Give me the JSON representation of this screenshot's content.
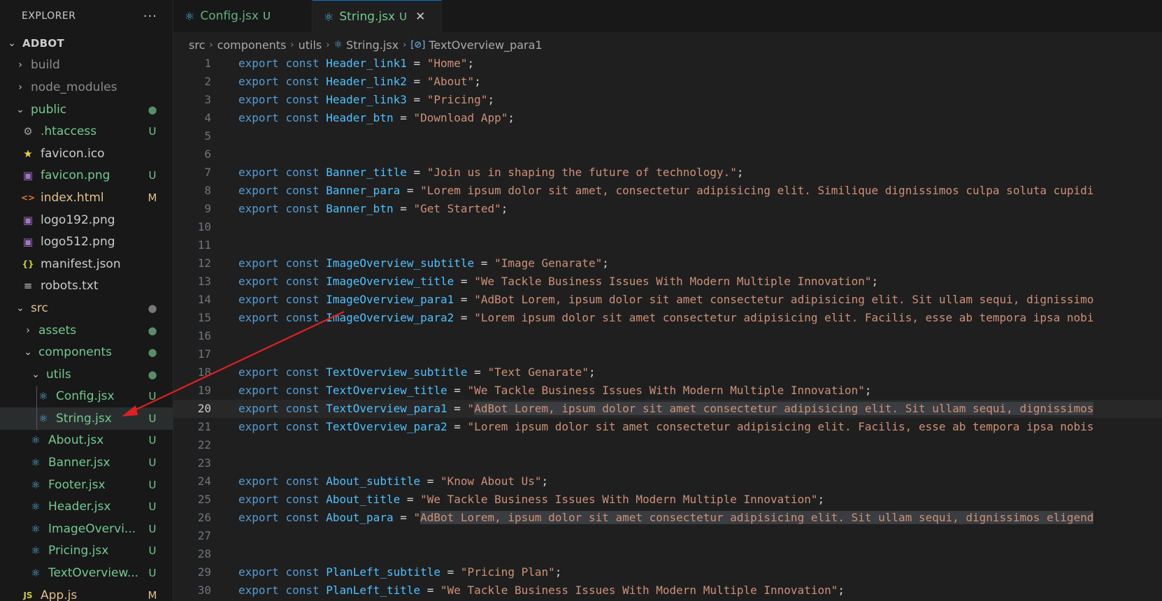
{
  "sidebar": {
    "title": "EXPLORER",
    "more_icon": "more-icon",
    "root": "ADBOT",
    "items": [
      {
        "label": "build",
        "type": "folder",
        "expanded": false,
        "depth": 1,
        "status": "ignored",
        "badge": ""
      },
      {
        "label": "node_modules",
        "type": "folder",
        "expanded": false,
        "depth": 1,
        "status": "ignored",
        "badge": ""
      },
      {
        "label": "public",
        "type": "folder",
        "expanded": true,
        "depth": 1,
        "status": "untracked",
        "badge": "●"
      },
      {
        "label": ".htaccess",
        "type": "file",
        "icon": "gear-icon",
        "depth": 2,
        "status": "untracked",
        "badge": "U"
      },
      {
        "label": "favicon.ico",
        "type": "file",
        "icon": "star-icon",
        "depth": 2,
        "status": "default",
        "badge": ""
      },
      {
        "label": "favicon.png",
        "type": "file",
        "icon": "image-icon",
        "depth": 2,
        "status": "untracked",
        "badge": "U"
      },
      {
        "label": "index.html",
        "type": "file",
        "icon": "html-icon",
        "depth": 2,
        "status": "modified",
        "badge": "M"
      },
      {
        "label": "logo192.png",
        "type": "file",
        "icon": "image-icon",
        "depth": 2,
        "status": "default",
        "badge": ""
      },
      {
        "label": "logo512.png",
        "type": "file",
        "icon": "image-icon",
        "depth": 2,
        "status": "default",
        "badge": ""
      },
      {
        "label": "manifest.json",
        "type": "file",
        "icon": "json-icon",
        "depth": 2,
        "status": "default",
        "badge": ""
      },
      {
        "label": "robots.txt",
        "type": "file",
        "icon": "text-file-icon",
        "depth": 2,
        "status": "default",
        "badge": ""
      },
      {
        "label": "src",
        "type": "folder",
        "expanded": true,
        "depth": 1,
        "status": "modified",
        "badge": "●"
      },
      {
        "label": "assets",
        "type": "folder",
        "expanded": false,
        "depth": 2,
        "status": "untracked",
        "badge": "●"
      },
      {
        "label": "components",
        "type": "folder",
        "expanded": true,
        "depth": 2,
        "status": "untracked",
        "badge": "●"
      },
      {
        "label": "utils",
        "type": "folder",
        "expanded": true,
        "depth": 3,
        "status": "untracked",
        "badge": "●"
      },
      {
        "label": "Config.jsx",
        "type": "file",
        "icon": "react-icon",
        "depth": 4,
        "status": "untracked",
        "badge": "U"
      },
      {
        "label": "String.jsx",
        "type": "file",
        "icon": "react-icon",
        "depth": 4,
        "status": "untracked",
        "badge": "U",
        "selected": true
      },
      {
        "label": "About.jsx",
        "type": "file",
        "icon": "react-icon",
        "depth": 3,
        "status": "untracked",
        "badge": "U"
      },
      {
        "label": "Banner.jsx",
        "type": "file",
        "icon": "react-icon",
        "depth": 3,
        "status": "untracked",
        "badge": "U"
      },
      {
        "label": "Footer.jsx",
        "type": "file",
        "icon": "react-icon",
        "depth": 3,
        "status": "untracked",
        "badge": "U"
      },
      {
        "label": "Header.jsx",
        "type": "file",
        "icon": "react-icon",
        "depth": 3,
        "status": "untracked",
        "badge": "U"
      },
      {
        "label": "ImageOvervi...",
        "type": "file",
        "icon": "react-icon",
        "depth": 3,
        "status": "untracked",
        "badge": "U"
      },
      {
        "label": "Pricing.jsx",
        "type": "file",
        "icon": "react-icon",
        "depth": 3,
        "status": "untracked",
        "badge": "U"
      },
      {
        "label": "TextOverview...",
        "type": "file",
        "icon": "react-icon",
        "depth": 3,
        "status": "untracked",
        "badge": "U"
      },
      {
        "label": "App.js",
        "type": "file",
        "icon": "js-icon",
        "depth": 2,
        "status": "modified",
        "badge": "M"
      }
    ]
  },
  "tabs": [
    {
      "label": "Config.jsx",
      "badge": "U",
      "active": false
    },
    {
      "label": "String.jsx",
      "badge": "U",
      "active": true,
      "close": "✕"
    }
  ],
  "breadcrumb": {
    "parts": [
      "src",
      "components",
      "utils"
    ],
    "file": "String.jsx",
    "symbol": "TextOverview_para1"
  },
  "editor": {
    "current_line": 20,
    "lines": [
      {
        "n": "1",
        "tokens": [
          [
            "kw",
            "export"
          ],
          [
            "op",
            " "
          ],
          [
            "kw",
            "const"
          ],
          [
            "op",
            " "
          ],
          [
            "id",
            "Header_link1"
          ],
          [
            "op",
            " = "
          ],
          [
            "str",
            "\"Home\""
          ],
          [
            "op",
            ";"
          ]
        ]
      },
      {
        "n": "2",
        "tokens": [
          [
            "kw",
            "export"
          ],
          [
            "op",
            " "
          ],
          [
            "kw",
            "const"
          ],
          [
            "op",
            " "
          ],
          [
            "id",
            "Header_link2"
          ],
          [
            "op",
            " = "
          ],
          [
            "str",
            "\"About\""
          ],
          [
            "op",
            ";"
          ]
        ]
      },
      {
        "n": "3",
        "tokens": [
          [
            "kw",
            "export"
          ],
          [
            "op",
            " "
          ],
          [
            "kw",
            "const"
          ],
          [
            "op",
            " "
          ],
          [
            "id",
            "Header_link3"
          ],
          [
            "op",
            " = "
          ],
          [
            "str",
            "\"Pricing\""
          ],
          [
            "op",
            ";"
          ]
        ]
      },
      {
        "n": "4",
        "tokens": [
          [
            "kw",
            "export"
          ],
          [
            "op",
            " "
          ],
          [
            "kw",
            "const"
          ],
          [
            "op",
            " "
          ],
          [
            "id",
            "Header_btn"
          ],
          [
            "op",
            " = "
          ],
          [
            "str",
            "\"Download App\""
          ],
          [
            "op",
            ";"
          ]
        ]
      },
      {
        "n": "5",
        "tokens": []
      },
      {
        "n": "6",
        "tokens": []
      },
      {
        "n": "7",
        "tokens": [
          [
            "kw",
            "export"
          ],
          [
            "op",
            " "
          ],
          [
            "kw",
            "const"
          ],
          [
            "op",
            " "
          ],
          [
            "id",
            "Banner_title"
          ],
          [
            "op",
            " = "
          ],
          [
            "str",
            "\"Join us in shaping the future of technology.\""
          ],
          [
            "op",
            ";"
          ]
        ]
      },
      {
        "n": "8",
        "tokens": [
          [
            "kw",
            "export"
          ],
          [
            "op",
            " "
          ],
          [
            "kw",
            "const"
          ],
          [
            "op",
            " "
          ],
          [
            "id",
            "Banner_para"
          ],
          [
            "op",
            " = "
          ],
          [
            "str",
            "\"Lorem ipsum dolor sit amet, consectetur adipisicing elit. Similique dignissimos culpa soluta cupidi"
          ]
        ]
      },
      {
        "n": "9",
        "tokens": [
          [
            "kw",
            "export"
          ],
          [
            "op",
            " "
          ],
          [
            "kw",
            "const"
          ],
          [
            "op",
            " "
          ],
          [
            "id",
            "Banner_btn"
          ],
          [
            "op",
            " = "
          ],
          [
            "str",
            "\"Get Started\""
          ],
          [
            "op",
            ";"
          ]
        ]
      },
      {
        "n": "10",
        "tokens": []
      },
      {
        "n": "11",
        "tokens": []
      },
      {
        "n": "12",
        "tokens": [
          [
            "kw",
            "export"
          ],
          [
            "op",
            " "
          ],
          [
            "kw",
            "const"
          ],
          [
            "op",
            " "
          ],
          [
            "id",
            "ImageOverview_subtitle"
          ],
          [
            "op",
            " = "
          ],
          [
            "str",
            "\"Image Genarate\""
          ],
          [
            "op",
            ";"
          ]
        ]
      },
      {
        "n": "13",
        "tokens": [
          [
            "kw",
            "export"
          ],
          [
            "op",
            " "
          ],
          [
            "kw",
            "const"
          ],
          [
            "op",
            " "
          ],
          [
            "id",
            "ImageOverview_title"
          ],
          [
            "op",
            " = "
          ],
          [
            "str",
            "\"We Tackle Business Issues With Modern Multiple Innovation\""
          ],
          [
            "op",
            ";"
          ]
        ]
      },
      {
        "n": "14",
        "tokens": [
          [
            "kw",
            "export"
          ],
          [
            "op",
            " "
          ],
          [
            "kw",
            "const"
          ],
          [
            "op",
            " "
          ],
          [
            "id",
            "ImageOverview_para1"
          ],
          [
            "op",
            " = "
          ],
          [
            "str",
            "\"AdBot Lorem, ipsum dolor sit amet consectetur adipisicing elit. Sit ullam sequi, dignissimo"
          ]
        ]
      },
      {
        "n": "15",
        "tokens": [
          [
            "kw",
            "export"
          ],
          [
            "op",
            " "
          ],
          [
            "kw",
            "const"
          ],
          [
            "op",
            " "
          ],
          [
            "id",
            "ImageOverview_para2"
          ],
          [
            "op",
            " = "
          ],
          [
            "str",
            "\"Lorem ipsum dolor sit amet consectetur adipisicing elit. Facilis, esse ab tempora ipsa nobi"
          ]
        ]
      },
      {
        "n": "16",
        "tokens": []
      },
      {
        "n": "17",
        "tokens": []
      },
      {
        "n": "18",
        "tokens": [
          [
            "kw",
            "export"
          ],
          [
            "op",
            " "
          ],
          [
            "kw",
            "const"
          ],
          [
            "op",
            " "
          ],
          [
            "id",
            "TextOverview_subtitle"
          ],
          [
            "op",
            " = "
          ],
          [
            "str",
            "\"Text Genarate\""
          ],
          [
            "op",
            ";"
          ]
        ]
      },
      {
        "n": "19",
        "tokens": [
          [
            "kw",
            "export"
          ],
          [
            "op",
            " "
          ],
          [
            "kw",
            "const"
          ],
          [
            "op",
            " "
          ],
          [
            "id",
            "TextOverview_title"
          ],
          [
            "op",
            " = "
          ],
          [
            "str",
            "\"We Tackle Business Issues With Modern Multiple Innovation\""
          ],
          [
            "op",
            ";"
          ]
        ]
      },
      {
        "n": "20",
        "tokens": [
          [
            "kw",
            "export"
          ],
          [
            "op",
            " "
          ],
          [
            "kw",
            "const"
          ],
          [
            "op",
            " "
          ],
          [
            "id",
            "TextOverview_para1"
          ],
          [
            "op",
            " = "
          ],
          [
            "str",
            "\""
          ],
          [
            "strhl",
            "AdBot Lorem, ipsum dolor sit amet consectetur adipisicing elit. Sit ullam sequi, dignissimos"
          ]
        ]
      },
      {
        "n": "21",
        "tokens": [
          [
            "kw",
            "export"
          ],
          [
            "op",
            " "
          ],
          [
            "kw",
            "const"
          ],
          [
            "op",
            " "
          ],
          [
            "id",
            "TextOverview_para2"
          ],
          [
            "op",
            " = "
          ],
          [
            "str",
            "\"Lorem ipsum dolor sit amet consectetur adipisicing elit. Facilis, esse ab tempora ipsa nobis"
          ]
        ]
      },
      {
        "n": "22",
        "tokens": []
      },
      {
        "n": "23",
        "tokens": []
      },
      {
        "n": "24",
        "tokens": [
          [
            "kw",
            "export"
          ],
          [
            "op",
            " "
          ],
          [
            "kw",
            "const"
          ],
          [
            "op",
            " "
          ],
          [
            "id",
            "About_subtitle"
          ],
          [
            "op",
            " = "
          ],
          [
            "str",
            "\"Know About Us\""
          ],
          [
            "op",
            ";"
          ]
        ]
      },
      {
        "n": "25",
        "tokens": [
          [
            "kw",
            "export"
          ],
          [
            "op",
            " "
          ],
          [
            "kw",
            "const"
          ],
          [
            "op",
            " "
          ],
          [
            "id",
            "About_title"
          ],
          [
            "op",
            " = "
          ],
          [
            "str",
            "\"We Tackle Business Issues With Modern Multiple Innovation\""
          ],
          [
            "op",
            ";"
          ]
        ]
      },
      {
        "n": "26",
        "tokens": [
          [
            "kw",
            "export"
          ],
          [
            "op",
            " "
          ],
          [
            "kw",
            "const"
          ],
          [
            "op",
            " "
          ],
          [
            "id",
            "About_para"
          ],
          [
            "op",
            " = "
          ],
          [
            "str",
            "\""
          ],
          [
            "strhl",
            "AdBot Lorem, ipsum dolor sit amet consectetur adipisicing elit. Sit ullam sequi, dignissimos eligend"
          ]
        ]
      },
      {
        "n": "27",
        "tokens": []
      },
      {
        "n": "28",
        "tokens": []
      },
      {
        "n": "29",
        "tokens": [
          [
            "kw",
            "export"
          ],
          [
            "op",
            " "
          ],
          [
            "kw",
            "const"
          ],
          [
            "op",
            " "
          ],
          [
            "id",
            "PlanLeft_subtitle"
          ],
          [
            "op",
            " = "
          ],
          [
            "str",
            "\"Pricing Plan\""
          ],
          [
            "op",
            ";"
          ]
        ]
      },
      {
        "n": "30",
        "tokens": [
          [
            "kw",
            "export"
          ],
          [
            "op",
            " "
          ],
          [
            "kw",
            "const"
          ],
          [
            "op",
            " "
          ],
          [
            "id",
            "PlanLeft_title"
          ],
          [
            "op",
            " = "
          ],
          [
            "str",
            "\"We Tackle Business Issues With Modern Multiple Innovation\""
          ],
          [
            "op",
            ";"
          ]
        ]
      }
    ]
  },
  "colors": {
    "untracked": "#73c991",
    "modified": "#e2c08d",
    "keyword": "#569cd6",
    "identifier": "#4fc1ff",
    "string": "#ce9178",
    "annotation_arrow": "#e02020"
  }
}
